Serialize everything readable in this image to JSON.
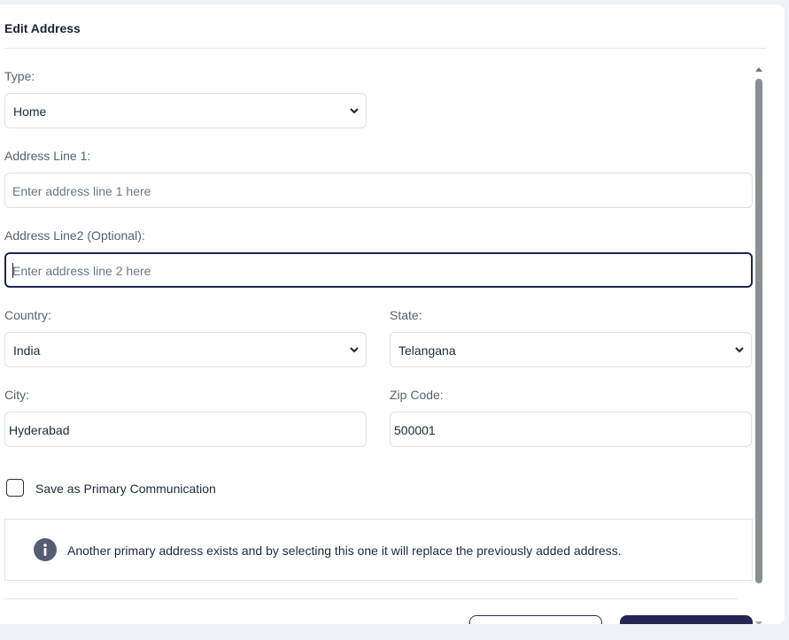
{
  "modal": {
    "title": "Edit Address"
  },
  "form": {
    "type": {
      "label": "Type:",
      "value": "Home"
    },
    "address1": {
      "label": "Address Line 1:",
      "placeholder": "Enter address line 1 here"
    },
    "address2": {
      "label": "Address Line2 (Optional):",
      "placeholder": "Enter address line 2 here"
    },
    "country": {
      "label": "Country:",
      "value": "India"
    },
    "state": {
      "label": "State:",
      "value": "Telangana"
    },
    "city": {
      "label": "City:",
      "value": "Hyderabad"
    },
    "zip": {
      "label": "Zip Code:",
      "value": "500001"
    },
    "primary_checkbox": {
      "label": "Save as Primary Communication",
      "checked": false
    },
    "info": {
      "text": "Another primary address exists and by selecting this one it will replace the previously added address."
    }
  },
  "colors": {
    "accent": "#212653",
    "border": "#dde1e6",
    "label": "#566270"
  },
  "icons": {
    "select_chevron": "chevron-down-icon",
    "info": "info-icon"
  }
}
